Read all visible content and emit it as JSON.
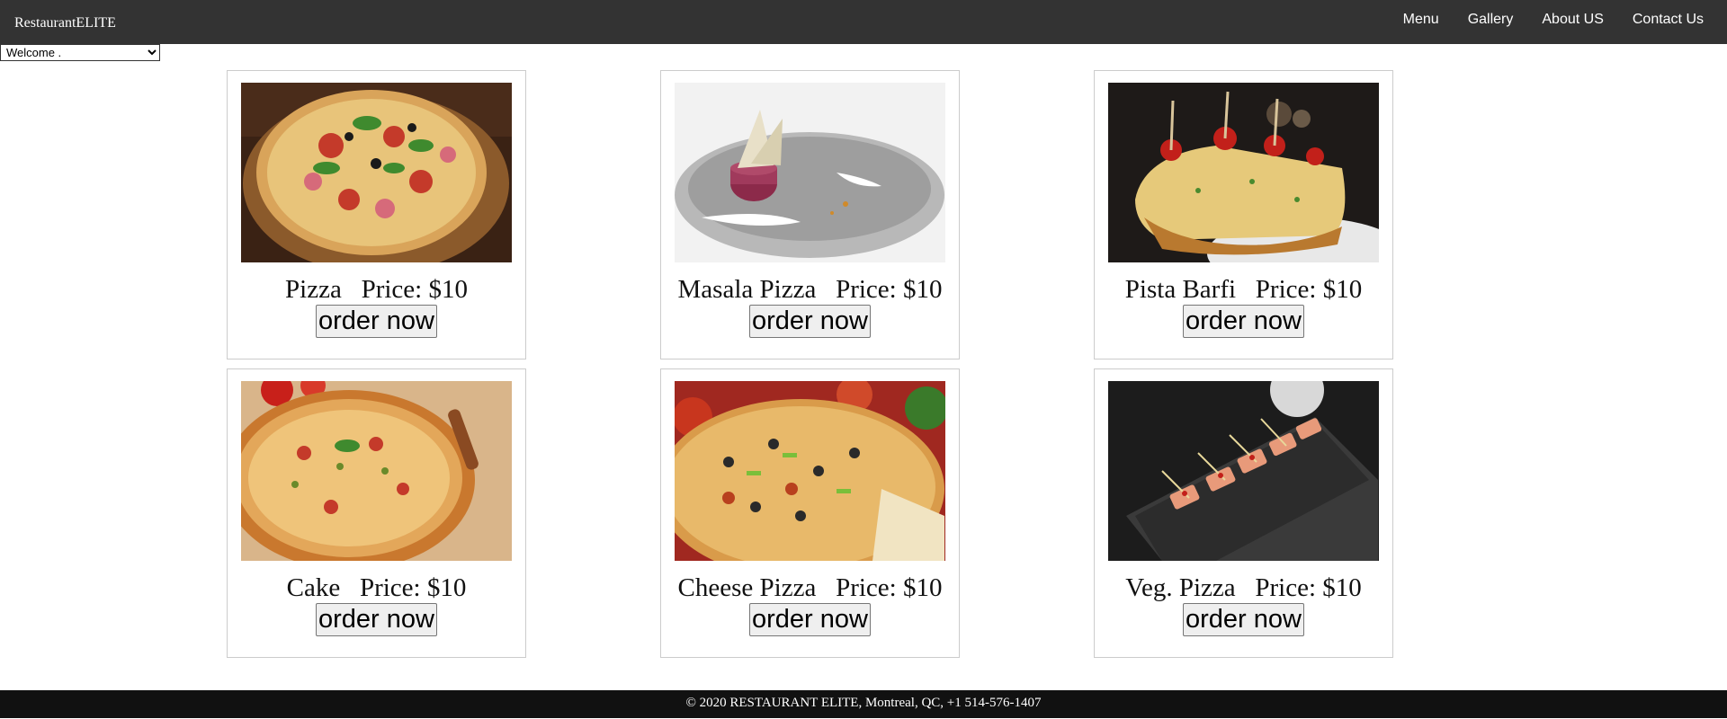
{
  "navbar": {
    "brand": "RestaurantELITE",
    "links": [
      "Menu",
      "Gallery",
      "About US",
      "Contact Us"
    ]
  },
  "welcome_select": {
    "selected": "Welcome ."
  },
  "menu_items": [
    {
      "name": "Pizza",
      "price_label": "Price: $10",
      "button": "order now",
      "image": "pizza-image"
    },
    {
      "name": "Masala Pizza",
      "price_label": "Price: $10",
      "button": "order now",
      "image": "masala-pizza-image"
    },
    {
      "name": "Pista Barfi",
      "price_label": "Price: $10",
      "button": "order now",
      "image": "pista-barfi-image"
    },
    {
      "name": "Cake",
      "price_label": "Price: $10",
      "button": "order now",
      "image": "cake-image"
    },
    {
      "name": "Cheese Pizza",
      "price_label": "Price: $10",
      "button": "order now",
      "image": "cheese-pizza-image"
    },
    {
      "name": "Veg. Pizza",
      "price_label": "Price: $10",
      "button": "order now",
      "image": "veg-pizza-image"
    }
  ],
  "footer": {
    "text": "© 2020 RESTAURANT ELITE, Montreal, QC, +1 514-576-1407"
  },
  "colors": {
    "navbar": "#333333",
    "footer": "#111111",
    "card_border": "#cccccc"
  }
}
